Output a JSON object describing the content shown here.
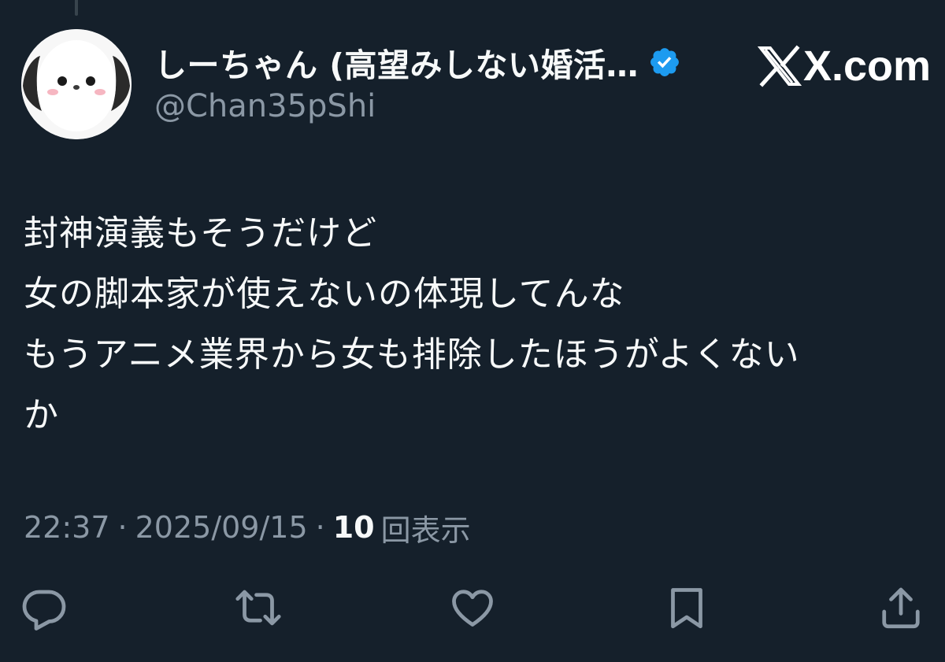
{
  "tweet": {
    "author": {
      "display_name": "しーちゃん (高望みしない婚活…",
      "handle": "@Chan35pShi",
      "verified": true,
      "avatar_icon": "bird-avatar-icon"
    },
    "brand": {
      "domain": "X.com",
      "logo_icon": "x-logo-icon"
    },
    "text_lines": [
      "封神演義もそうだけど",
      "女の脚本家が使えないの体現してんな",
      "もうアニメ業界から女も排除したほうがよくない",
      "か"
    ],
    "meta": {
      "time": "22:37",
      "separator": "·",
      "date": "2025/09/15",
      "views_count": "10",
      "views_label": "回表示"
    },
    "actions": [
      {
        "name": "reply",
        "icon": "reply-icon"
      },
      {
        "name": "repost",
        "icon": "repost-icon"
      },
      {
        "name": "like",
        "icon": "heart-icon"
      },
      {
        "name": "bookmark",
        "icon": "bookmark-icon"
      },
      {
        "name": "share",
        "icon": "share-icon"
      }
    ],
    "colors": {
      "background": "#15202b",
      "primary_text": "#f7f9f9",
      "secondary_text": "#8b98a5",
      "verified_blue": "#1d9bf0"
    }
  }
}
